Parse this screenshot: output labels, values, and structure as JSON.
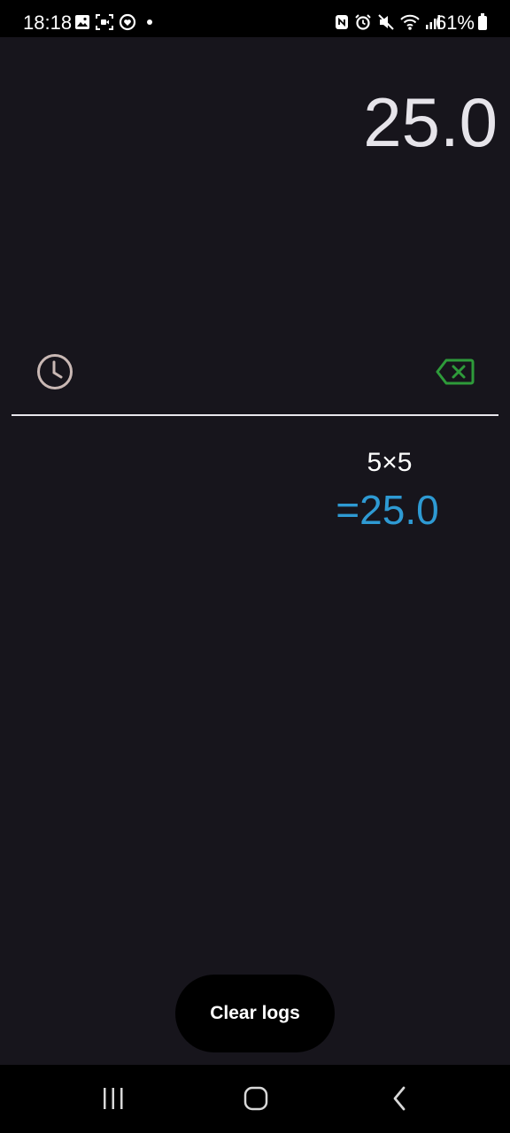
{
  "status_bar": {
    "time": "18:18",
    "battery_percent": "61%",
    "left_icons": [
      "gallery-icon",
      "screen-recorder-icon",
      "health-icon",
      "dot-icon"
    ],
    "right_icons": [
      "nfc-icon",
      "alarm-icon",
      "mute-icon",
      "wifi-icon",
      "signal-icon",
      "battery-icon"
    ]
  },
  "display": {
    "value": "25.0"
  },
  "toolbar": {
    "history_icon": "clock-icon",
    "backspace_icon": "backspace-icon",
    "backspace_color": "#2e9b3a",
    "history_color": "#c9b8b4"
  },
  "log": {
    "entries": [
      {
        "expression": "5×5",
        "result": "=25.0"
      }
    ],
    "result_color": "#2e9ad3"
  },
  "clear_logs_label": "Clear logs",
  "nav_bar": {
    "icons": [
      "recent-apps-icon",
      "home-icon",
      "back-icon"
    ]
  }
}
